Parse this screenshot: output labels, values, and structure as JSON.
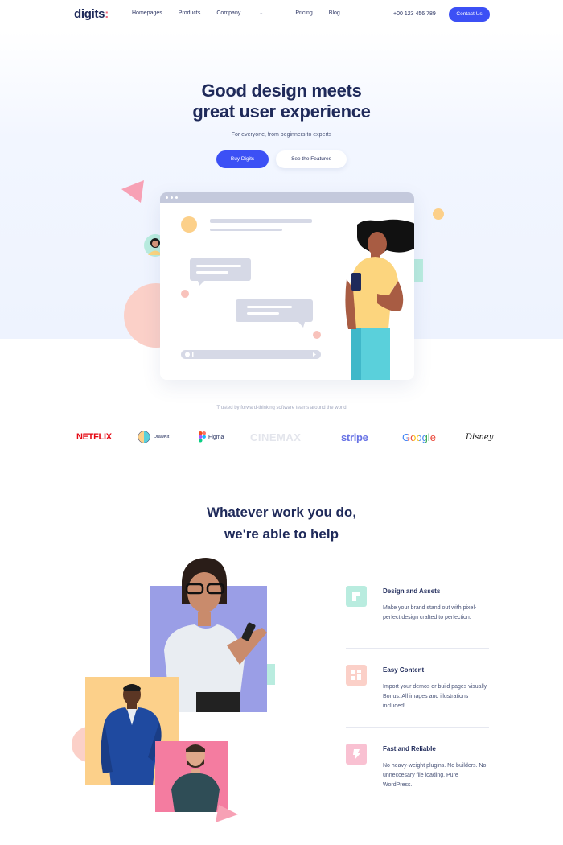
{
  "nav": {
    "logo": "digits",
    "logo_suffix": ":",
    "links": [
      "Homepages",
      "Products",
      "Company",
      "Pricing",
      "Blog"
    ],
    "phone": "+00 123 456 789",
    "contact_label": "Contact Us"
  },
  "hero": {
    "title_line1": "Good design meets",
    "title_line2": "great user experience",
    "subtitle": "For everyone, from beginners to experts",
    "buy_label": "Buy Digits",
    "features_label": "See the Features"
  },
  "trusted": {
    "text": "Trusted by forward-thinking software teams around the world",
    "logos": [
      "NETFLIX",
      "DrawKit",
      "Figma",
      "CINEMAX",
      "stripe",
      "Google",
      "Disney"
    ]
  },
  "section2": {
    "title_line1": "Whatever work you do,",
    "title_line2": "we're able to help",
    "features": [
      {
        "title": "Design and Assets",
        "text": "Make your brand stand out with pixel-perfect design crafted to perfection.",
        "color": "#b9ecdf"
      },
      {
        "title": "Easy Content",
        "text": "Import your demos or build pages visually. Bonus: All images and illustrations included!",
        "color": "#fbd0c8"
      },
      {
        "title": "Fast and Reliable",
        "text": "No heavy-weight plugins. No builders. No unneccesary file loading. Pure WordPress.",
        "color": "#f9c1d2"
      }
    ]
  },
  "colors": {
    "accent": "#3c50f5",
    "navy": "#1f2a5a",
    "coral": "#f06a7d"
  }
}
